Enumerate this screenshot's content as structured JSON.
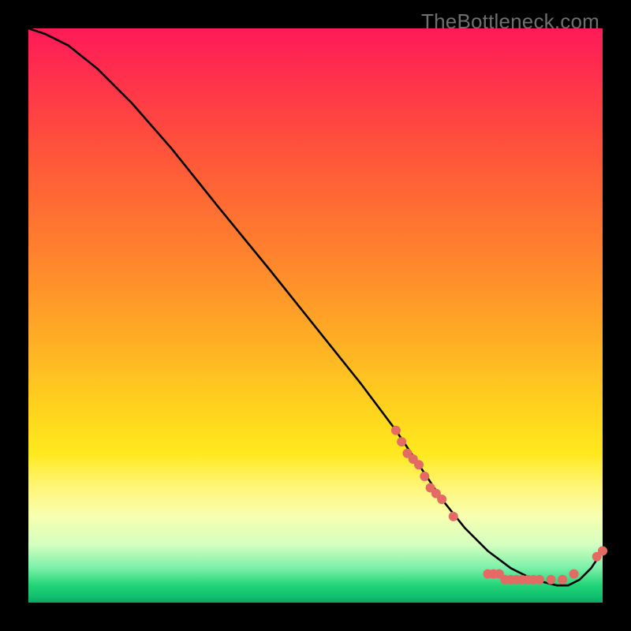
{
  "watermark": "TheBottleneck.com",
  "chart_data": {
    "type": "line",
    "title": "",
    "xlabel": "",
    "ylabel": "",
    "xlim": [
      0,
      100
    ],
    "ylim": [
      0,
      100
    ],
    "grid": false,
    "legend": false,
    "series": [
      {
        "name": "bottleneck-curve",
        "color": "#000000",
        "x": [
          0,
          3,
          7,
          12,
          18,
          25,
          33,
          42,
          50,
          58,
          64,
          68,
          72,
          76,
          80,
          84,
          88,
          92,
          94,
          96,
          98,
          100
        ],
        "y": [
          100,
          99,
          97,
          93,
          87,
          79,
          69,
          58,
          48,
          38,
          30,
          24,
          18,
          13,
          9,
          6,
          4,
          3,
          3,
          4,
          6,
          9
        ]
      }
    ],
    "markers": [
      {
        "name": "cluster-descending",
        "color": "#e46a64",
        "radius": 6,
        "points": [
          {
            "x": 64,
            "y": 30
          },
          {
            "x": 65,
            "y": 28
          },
          {
            "x": 66,
            "y": 26
          },
          {
            "x": 67,
            "y": 25
          },
          {
            "x": 68,
            "y": 24
          },
          {
            "x": 69,
            "y": 22
          },
          {
            "x": 70,
            "y": 20
          },
          {
            "x": 71,
            "y": 19
          },
          {
            "x": 72,
            "y": 18
          },
          {
            "x": 74,
            "y": 15
          }
        ]
      },
      {
        "name": "cluster-bottom",
        "color": "#e46a64",
        "radius": 6,
        "points": [
          {
            "x": 80,
            "y": 5
          },
          {
            "x": 81,
            "y": 5
          },
          {
            "x": 82,
            "y": 5
          },
          {
            "x": 83,
            "y": 4
          },
          {
            "x": 84,
            "y": 4
          },
          {
            "x": 85,
            "y": 4
          },
          {
            "x": 86,
            "y": 4
          },
          {
            "x": 87,
            "y": 4
          },
          {
            "x": 88,
            "y": 4
          },
          {
            "x": 89,
            "y": 4
          },
          {
            "x": 91,
            "y": 4
          },
          {
            "x": 93,
            "y": 4
          },
          {
            "x": 95,
            "y": 5
          }
        ]
      },
      {
        "name": "cluster-tail",
        "color": "#e46a64",
        "radius": 6,
        "points": [
          {
            "x": 99,
            "y": 8
          },
          {
            "x": 100,
            "y": 9
          }
        ]
      }
    ]
  }
}
